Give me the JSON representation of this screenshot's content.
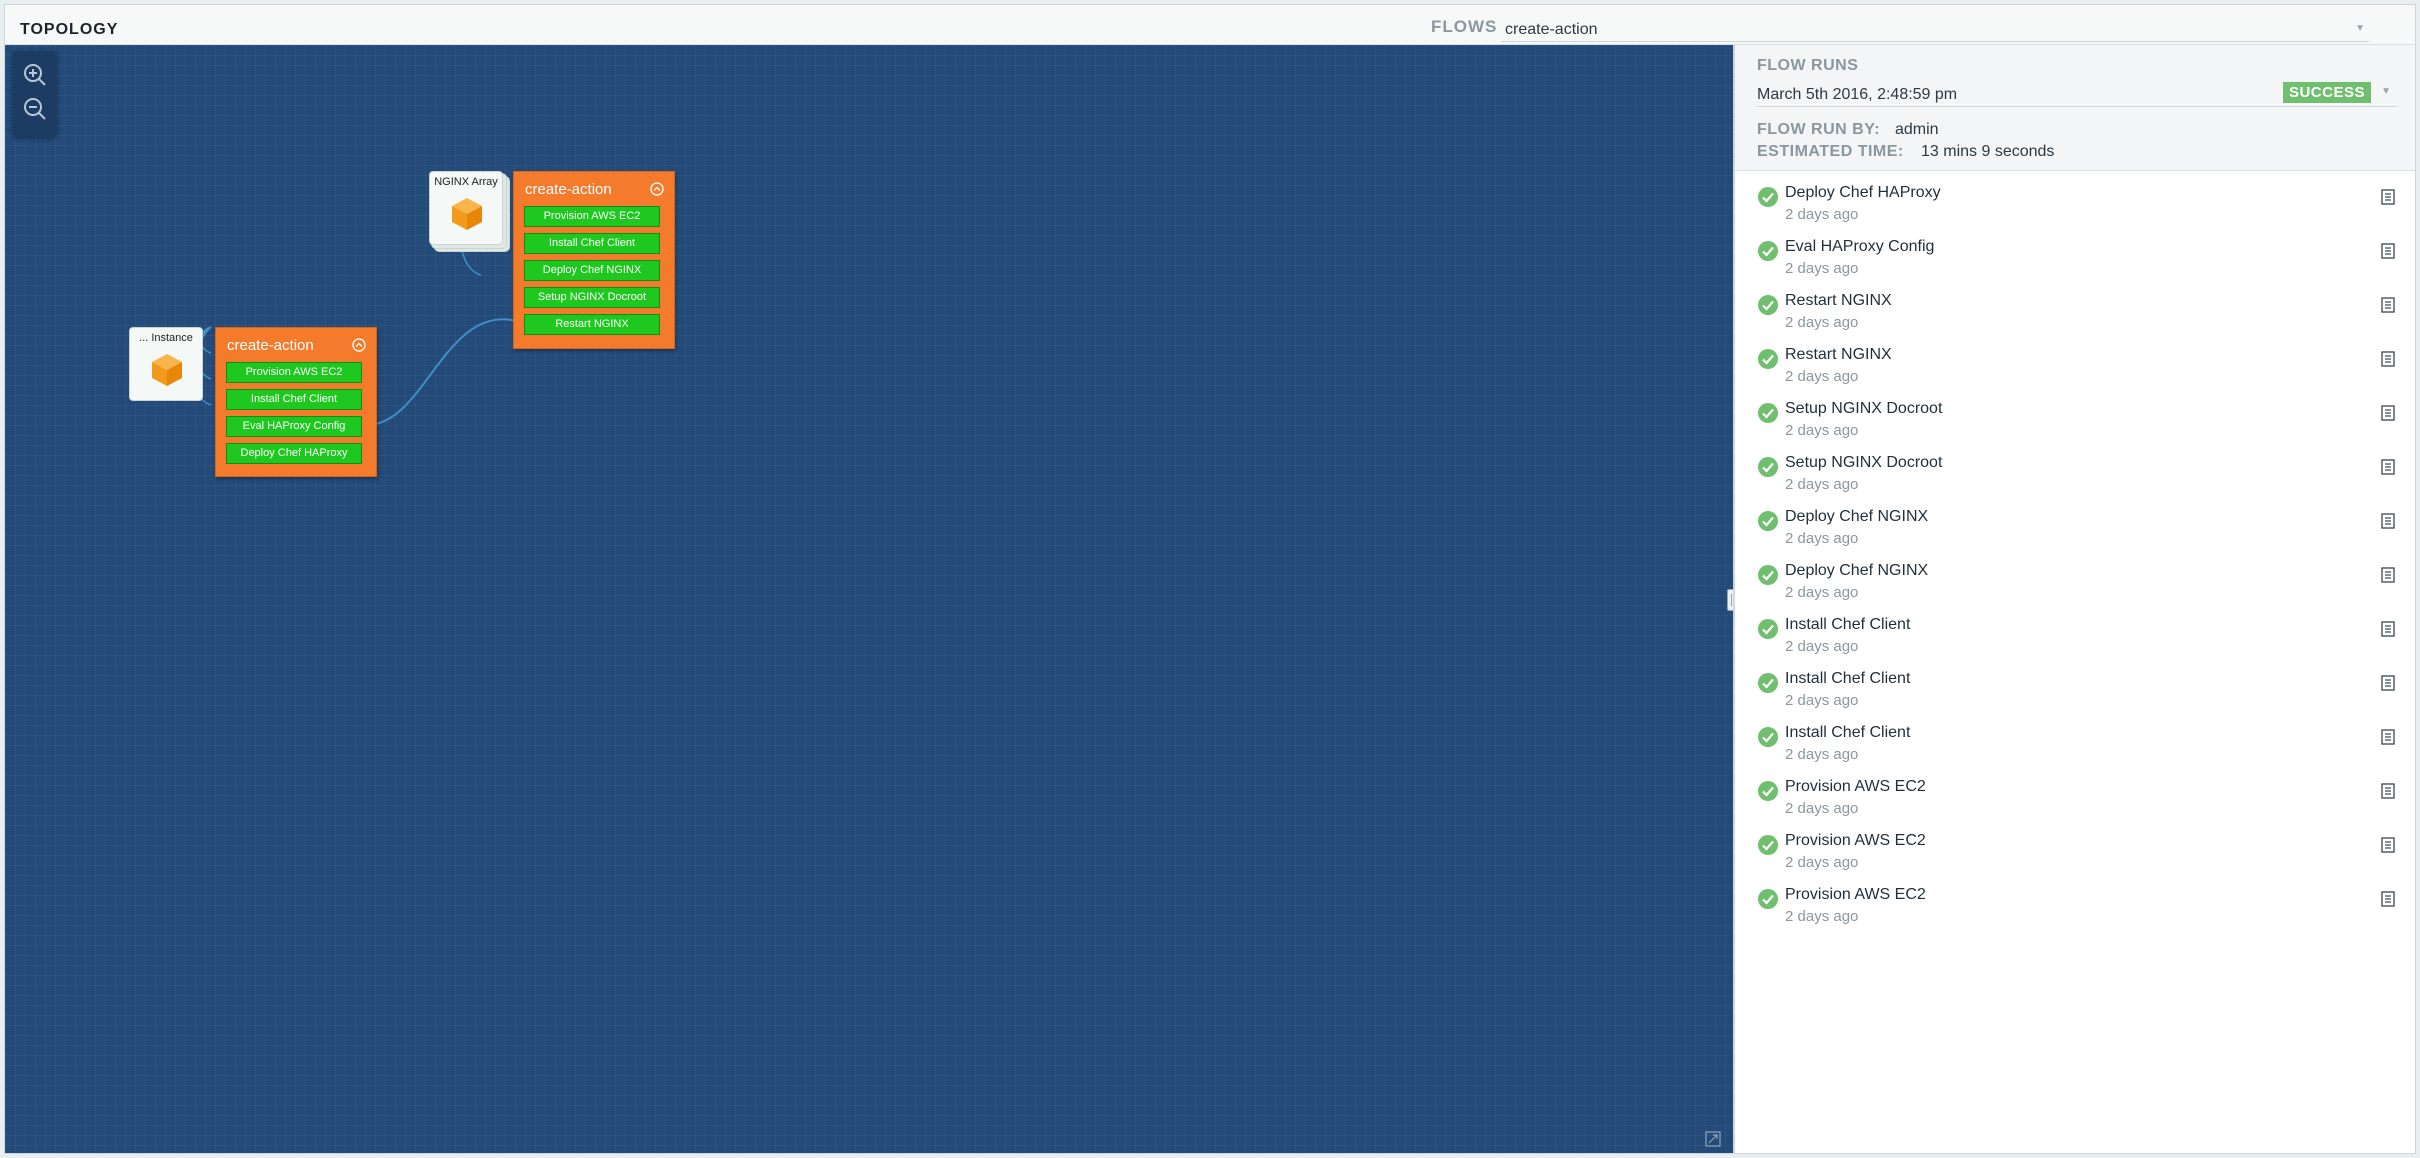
{
  "header": {
    "title": "TOPOLOGY",
    "flows_label": "FLOWS",
    "flows_value": "create-action"
  },
  "canvas": {
    "background_color": "#234a78",
    "zoom_in_icon": "zoom-in-icon",
    "zoom_out_icon": "zoom-out-icon",
    "nodes": [
      {
        "resource_label": "NGINX Array",
        "action_title": "create-action",
        "steps": [
          "Provision AWS EC2",
          "Install Chef Client",
          "Deploy Chef NGINX",
          "Setup NGINX Docroot",
          "Restart NGINX"
        ]
      },
      {
        "resource_label": "... Instance",
        "action_title": "create-action",
        "steps": [
          "Provision AWS EC2",
          "Install Chef Client",
          "Eval HAProxy Config",
          "Deploy Chef HAProxy"
        ]
      }
    ]
  },
  "panel": {
    "flow_runs_label": "FLOW RUNS",
    "run_date": "March 5th 2016, 2:48:59 pm",
    "run_status": "SUCCESS",
    "run_by_label": "FLOW RUN BY:",
    "run_by_value": "admin",
    "est_time_label": "ESTIMATED TIME:",
    "est_time_value": "13 mins 9 seconds",
    "status_color": "#6fbf6f",
    "tasks": [
      {
        "name": "Deploy Chef HAProxy",
        "time": "2 days ago"
      },
      {
        "name": "Eval HAProxy Config",
        "time": "2 days ago"
      },
      {
        "name": "Restart NGINX",
        "time": "2 days ago"
      },
      {
        "name": "Restart NGINX",
        "time": "2 days ago"
      },
      {
        "name": "Setup NGINX Docroot",
        "time": "2 days ago"
      },
      {
        "name": "Setup NGINX Docroot",
        "time": "2 days ago"
      },
      {
        "name": "Deploy Chef NGINX",
        "time": "2 days ago"
      },
      {
        "name": "Deploy Chef NGINX",
        "time": "2 days ago"
      },
      {
        "name": "Install Chef Client",
        "time": "2 days ago"
      },
      {
        "name": "Install Chef Client",
        "time": "2 days ago"
      },
      {
        "name": "Install Chef Client",
        "time": "2 days ago"
      },
      {
        "name": "Provision AWS EC2",
        "time": "2 days ago"
      },
      {
        "name": "Provision AWS EC2",
        "time": "2 days ago"
      },
      {
        "name": "Provision AWS EC2",
        "time": "2 days ago"
      }
    ]
  }
}
